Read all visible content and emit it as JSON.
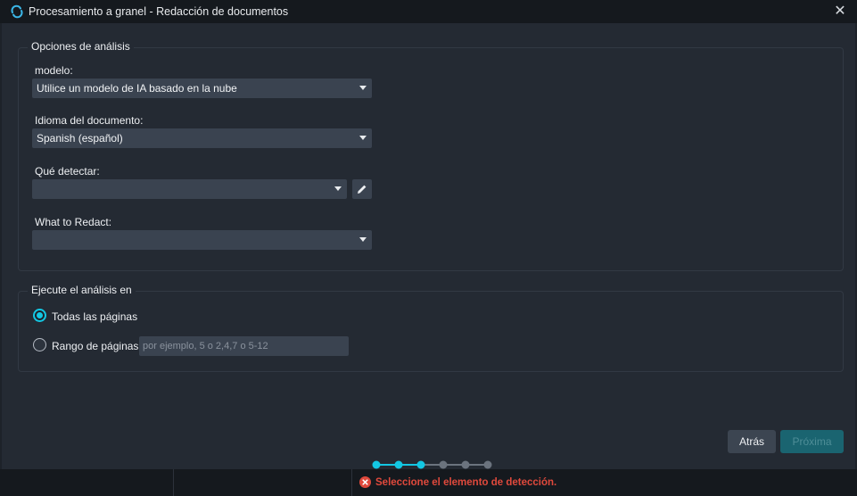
{
  "window": {
    "title": "Procesamiento a granel - Redacción de documentos",
    "close_glyph": "✕",
    "app_icon": "sync-icon"
  },
  "analysis_options": {
    "legend": "Opciones de análisis",
    "model": {
      "label": "modelo:",
      "value": "Utilice un modelo de IA basado en la nube"
    },
    "language": {
      "label": "Idioma del documento:",
      "value": "Spanish (español)"
    },
    "detect": {
      "label": "Qué detectar:",
      "value": "",
      "edit_icon": "pencil-icon"
    },
    "redact": {
      "label": "What to Redact:",
      "value": ""
    }
  },
  "run_analysis": {
    "legend": "Ejecute el análisis en",
    "all_pages_label": "Todas las páginas",
    "all_pages_selected": true,
    "range_label": "Rango de páginas",
    "range_selected": false,
    "range_value": "",
    "range_placeholder": "por ejemplo, 5 o 2,4,7 o 5-12"
  },
  "wizard": {
    "total_steps": 6,
    "completed_steps": 3,
    "active_color": "#13c7e3",
    "inactive_color": "#6b737e"
  },
  "buttons": {
    "back_label": "Atrás",
    "next_label": "Próxima"
  },
  "status": {
    "error_message": "Seleccione el elemento de detección.",
    "error_color": "#e0493c"
  }
}
